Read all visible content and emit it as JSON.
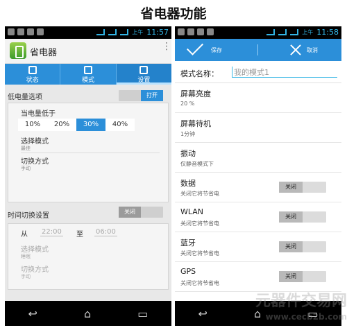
{
  "page": {
    "title": "省电器功能"
  },
  "status_left": {
    "time": "11:57",
    "ampm": "上午"
  },
  "status_right": {
    "time": "11:58",
    "ampm": "上午"
  },
  "app": {
    "name": "省电器",
    "tabs": [
      {
        "label": "状态",
        "icon": "status-icon"
      },
      {
        "label": "模式",
        "icon": "mode-icon"
      },
      {
        "label": "设置",
        "icon": "settings-sliders-icon"
      }
    ],
    "active_tab": 2
  },
  "low_battery": {
    "header": "低电量选项",
    "toggle": "打开",
    "below_label": "当电量低于",
    "options": [
      "10%",
      "20%",
      "30%",
      "40%"
    ],
    "selected": "30%",
    "mode_label": "选择模式",
    "mode_value": "最佳",
    "switch_label": "切换方式",
    "switch_value": "手动"
  },
  "time_switch": {
    "header": "时间切换设置",
    "toggle": "关闭",
    "from_label": "从",
    "from_value": "22:00",
    "to_label": "至",
    "to_value": "06:00",
    "mode_label": "选择模式",
    "mode_value": "睡眠",
    "switch_label": "切换方式",
    "switch_value": "手动"
  },
  "editor": {
    "save": "保存",
    "cancel": "取消",
    "name_label": "模式名称：",
    "name_placeholder": "我的模式1",
    "settings": [
      {
        "title": "屏幕亮度",
        "sub": "20 %"
      },
      {
        "title": "屏幕待机",
        "sub": "1分钟"
      },
      {
        "title": "振动",
        "sub": "仅静音模式下"
      },
      {
        "title": "数据",
        "sub": "关闭它将节省电",
        "toggle": "关闭"
      },
      {
        "title": "WLAN",
        "sub": "关闭它将节省电",
        "toggle": "关闭"
      },
      {
        "title": "蓝牙",
        "sub": "关闭它将节省电",
        "toggle": "关闭"
      },
      {
        "title": "GPS",
        "sub": "关闭它将节省电",
        "toggle": "关闭"
      }
    ]
  },
  "watermark": {
    "line1": "元器件交易网",
    "line2": "www.cecb2b.com"
  },
  "colors": {
    "accent": "#2c8fd9",
    "status_icon": "#33b5e5"
  }
}
